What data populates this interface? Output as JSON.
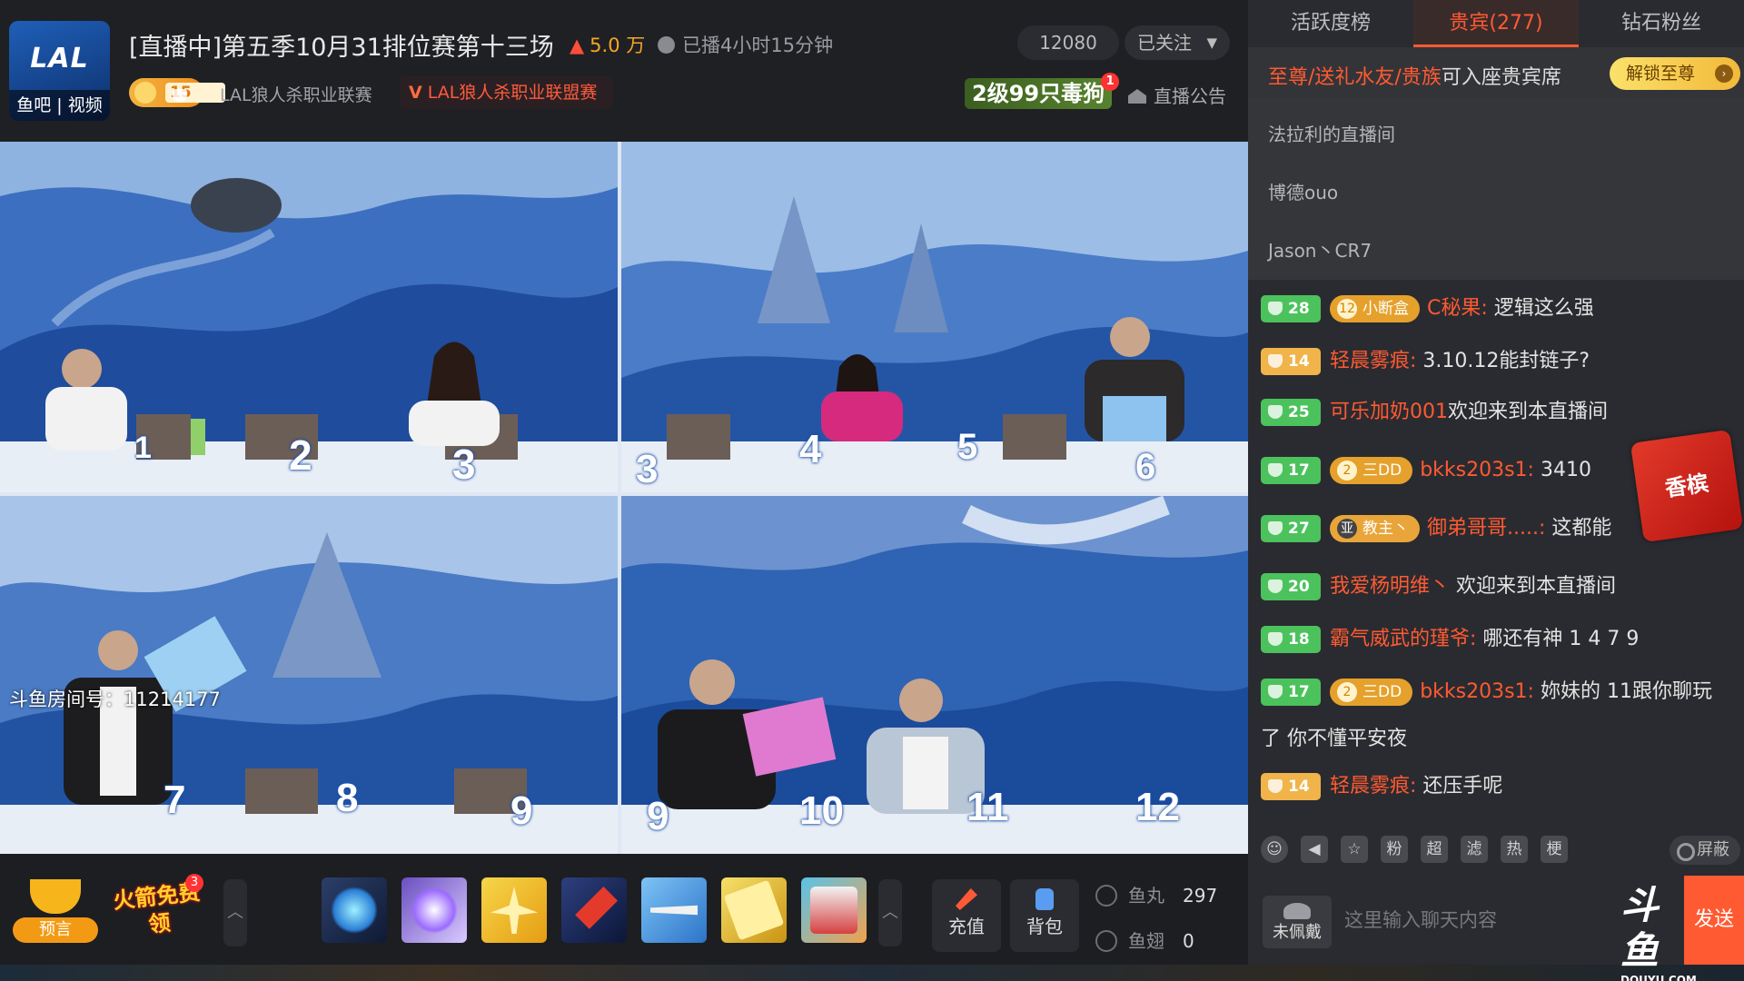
{
  "header": {
    "logo_text": "LAL",
    "logo_sub": "鱼吧 | 视频",
    "title": "[直播中]第五季10月31排位赛第十三场",
    "hot": "5.0 万",
    "duration": "已播4小时15分钟",
    "viewers": "12080",
    "follow_label": "已关注",
    "fan_level": "15",
    "guild_name": "LAL狼人杀职业联赛",
    "guild_link": "LAL狼人杀职业联盟赛",
    "gift_banner": "2级99只毒狗",
    "gift_banner_badge": "1",
    "announce_label": "直播公告"
  },
  "video": {
    "room_id_text": "斗鱼房间号：11214177",
    "seat_numbers": [
      "1",
      "2",
      "3",
      "3",
      "4",
      "5",
      "6",
      "7",
      "8",
      "9",
      "9",
      "10",
      "11",
      "12"
    ]
  },
  "toolbar": {
    "predict_label": "预言",
    "rocket_label": "火箭免费领",
    "rocket_badge": "3",
    "recharge_label": "充值",
    "backpack_label": "背包",
    "fish_ball_label": "鱼丸",
    "fish_ball_value": "297",
    "fish_fin_label": "鱼翅",
    "fish_fin_value": "0",
    "gifts": [
      "gem-icon",
      "galaxy-icon",
      "plane-gold-icon",
      "rocket-icon",
      "jet-icon",
      "card-icon",
      "scene-icon"
    ]
  },
  "panel": {
    "tabs": [
      "活跃度榜",
      "贵宾(277)",
      "钻石粉丝"
    ],
    "vip_bar": {
      "prefix": "至尊/送礼水友/贵族",
      "suffix": "可入座贵宾席",
      "unlock": "解锁至尊"
    },
    "vip_list": [
      "法拉利的直播间",
      "博德ouo",
      "Jason丶CR7"
    ],
    "messages": [
      {
        "level": "28",
        "fan_num": "12",
        "fan_name": "小断盒",
        "name": "C秘果:",
        "text": "逻辑这么强"
      },
      {
        "level": "14",
        "name": "轻晨雾痕:",
        "text": "3.10.12能封链子?"
      },
      {
        "level": "25",
        "name": "可乐加奶001",
        "text": "欢迎来到本直播间"
      },
      {
        "level": "17",
        "fan_num": "2",
        "fan_name": "三DD",
        "name": "bkks203s1:",
        "text": "3410"
      },
      {
        "level": "27",
        "fan_name": "教主丶",
        "name": "御弟哥哥.....:",
        "text": "这都能"
      },
      {
        "level": "20",
        "name": "我爱杨明维丶",
        "text": "欢迎来到本直播间"
      },
      {
        "level": "18",
        "name": "霸气威武的瑾爷:",
        "text": "哪还有神 1 4 7 9"
      },
      {
        "level": "17",
        "fan_num": "2",
        "fan_name": "三DD",
        "name": "bkks203s1:",
        "text": "妳妹的 11跟你聊玩"
      },
      {
        "continuation": "了 你不懂平安夜"
      },
      {
        "level": "14",
        "name": "轻晨雾痕:",
        "text": "还压手呢"
      }
    ],
    "promo_text": "香槟",
    "tool_buttons": [
      "粉",
      "超",
      "滤",
      "热",
      "梗"
    ],
    "shield_label": "屏蔽",
    "wear_label": "未佩戴",
    "input_placeholder": "这里输入聊天内容",
    "send_label": "发送",
    "brand": "斗鱼",
    "brand_url_text": "DOUYU.COM"
  }
}
